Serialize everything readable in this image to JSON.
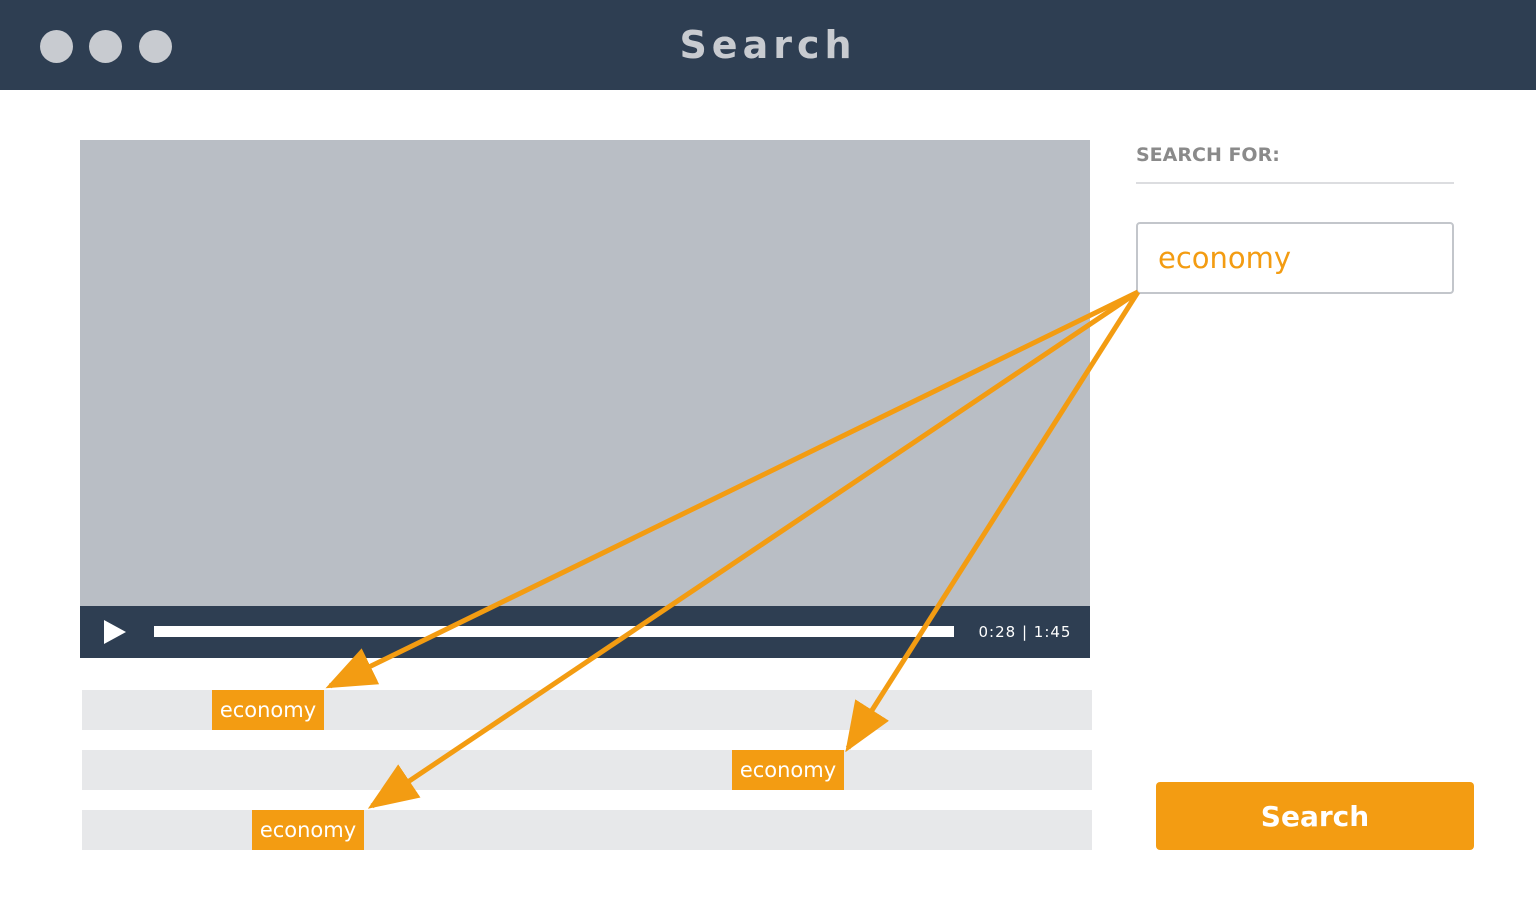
{
  "window": {
    "title": "Search"
  },
  "player": {
    "current_time": "0:28",
    "separator": "|",
    "duration": "1:45",
    "time_display": "0:28 | 1:45"
  },
  "results": [
    {
      "label": "economy"
    },
    {
      "label": "economy"
    },
    {
      "label": "economy"
    }
  ],
  "search_panel": {
    "label": "SEARCH FOR:",
    "query": "economy",
    "button_label": "Search"
  },
  "colors": {
    "titlebar": "#2e3e52",
    "accent": "#f39c12",
    "video_placeholder": "#b9bec5",
    "track": "#e7e8ea"
  },
  "icons": {
    "play": "play-icon",
    "window_controls": [
      "window-close-icon",
      "window-minimize-icon",
      "window-maximize-icon"
    ]
  }
}
